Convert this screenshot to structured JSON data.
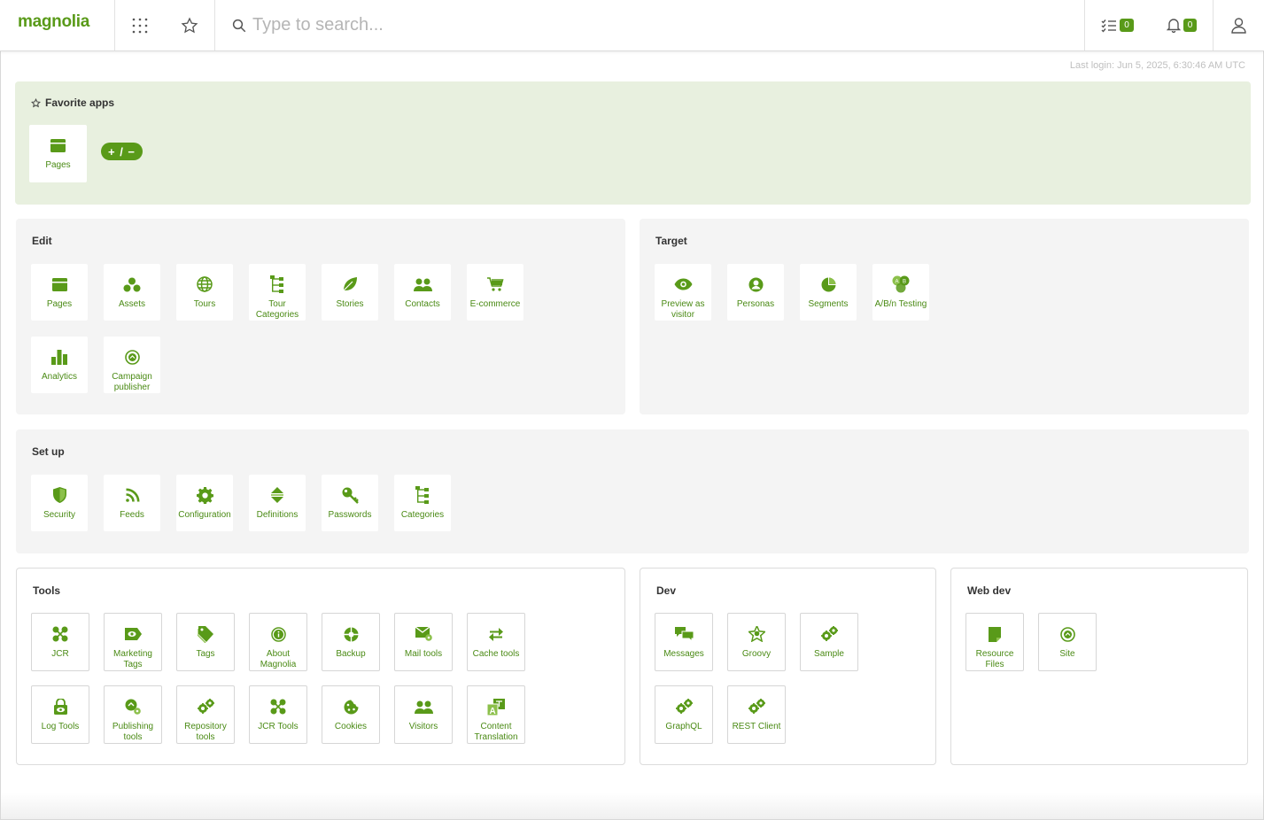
{
  "brand": {
    "name": "magnolia",
    "accent": "#599a19"
  },
  "header": {
    "search_placeholder": "Type to search...",
    "tasks_count": "0",
    "notifications_count": "0"
  },
  "last_login": "Last login: Jun 5, 2025, 6:30:46 AM UTC",
  "favorites": {
    "title": "Favorite apps",
    "apps": [
      {
        "label": "Pages",
        "icon": "pages-icon"
      }
    ],
    "edit_label": "+ / −"
  },
  "edit": {
    "title": "Edit",
    "apps": [
      {
        "label": "Pages",
        "icon": "pages-icon"
      },
      {
        "label": "Assets",
        "icon": "assets-icon"
      },
      {
        "label": "Tours",
        "icon": "globe-icon"
      },
      {
        "label": "Tour Categories",
        "icon": "tree-icon"
      },
      {
        "label": "Stories",
        "icon": "leaf-icon"
      },
      {
        "label": "Contacts",
        "icon": "contacts-icon"
      },
      {
        "label": "E-commerce",
        "icon": "cart-icon"
      },
      {
        "label": "Analytics",
        "icon": "bar-chart-icon"
      },
      {
        "label": "Campaign publisher",
        "icon": "campaign-icon"
      }
    ]
  },
  "target": {
    "title": "Target",
    "apps": [
      {
        "label": "Preview as visitor",
        "icon": "eye-icon"
      },
      {
        "label": "Personas",
        "icon": "persona-icon"
      },
      {
        "label": "Segments",
        "icon": "pie-icon"
      },
      {
        "label": "A/B/n Testing",
        "icon": "ab-test-icon"
      }
    ]
  },
  "setup": {
    "title": "Set up",
    "apps": [
      {
        "label": "Security",
        "icon": "shield-icon"
      },
      {
        "label": "Feeds",
        "icon": "rss-icon"
      },
      {
        "label": "Configuration",
        "icon": "gear-icon"
      },
      {
        "label": "Definitions",
        "icon": "definitions-icon"
      },
      {
        "label": "Passwords",
        "icon": "key-icon"
      },
      {
        "label": "Categories",
        "icon": "tree-icon"
      }
    ]
  },
  "tools": {
    "title": "Tools",
    "apps": [
      {
        "label": "JCR",
        "icon": "jcr-icon"
      },
      {
        "label": "Marketing Tags",
        "icon": "tag-eye-icon"
      },
      {
        "label": "Tags",
        "icon": "tags-icon"
      },
      {
        "label": "About Magnolia",
        "icon": "info-icon"
      },
      {
        "label": "Backup",
        "icon": "backup-icon"
      },
      {
        "label": "Mail tools",
        "icon": "mail-icon"
      },
      {
        "label": "Cache tools",
        "icon": "swap-icon"
      },
      {
        "label": "Log Tools",
        "icon": "lock-eye-icon"
      },
      {
        "label": "Publishing tools",
        "icon": "publish-icon"
      },
      {
        "label": "Repository tools",
        "icon": "gears-icon"
      },
      {
        "label": "JCR Tools",
        "icon": "jcr-icon"
      },
      {
        "label": "Cookies",
        "icon": "cookie-icon"
      },
      {
        "label": "Visitors",
        "icon": "contacts-icon"
      },
      {
        "label": "Content Translation",
        "icon": "translate-icon"
      }
    ]
  },
  "dev": {
    "title": "Dev",
    "apps": [
      {
        "label": "Messages",
        "icon": "messages-icon"
      },
      {
        "label": "Groovy",
        "icon": "groovy-icon"
      },
      {
        "label": "Sample",
        "icon": "gears-icon"
      },
      {
        "label": "GraphQL",
        "icon": "gears-icon"
      },
      {
        "label": "REST Client",
        "icon": "gears-icon"
      }
    ]
  },
  "webdev": {
    "title": "Web dev",
    "apps": [
      {
        "label": "Resource Files",
        "icon": "file-icon"
      },
      {
        "label": "Site",
        "icon": "campaign-icon"
      }
    ]
  }
}
